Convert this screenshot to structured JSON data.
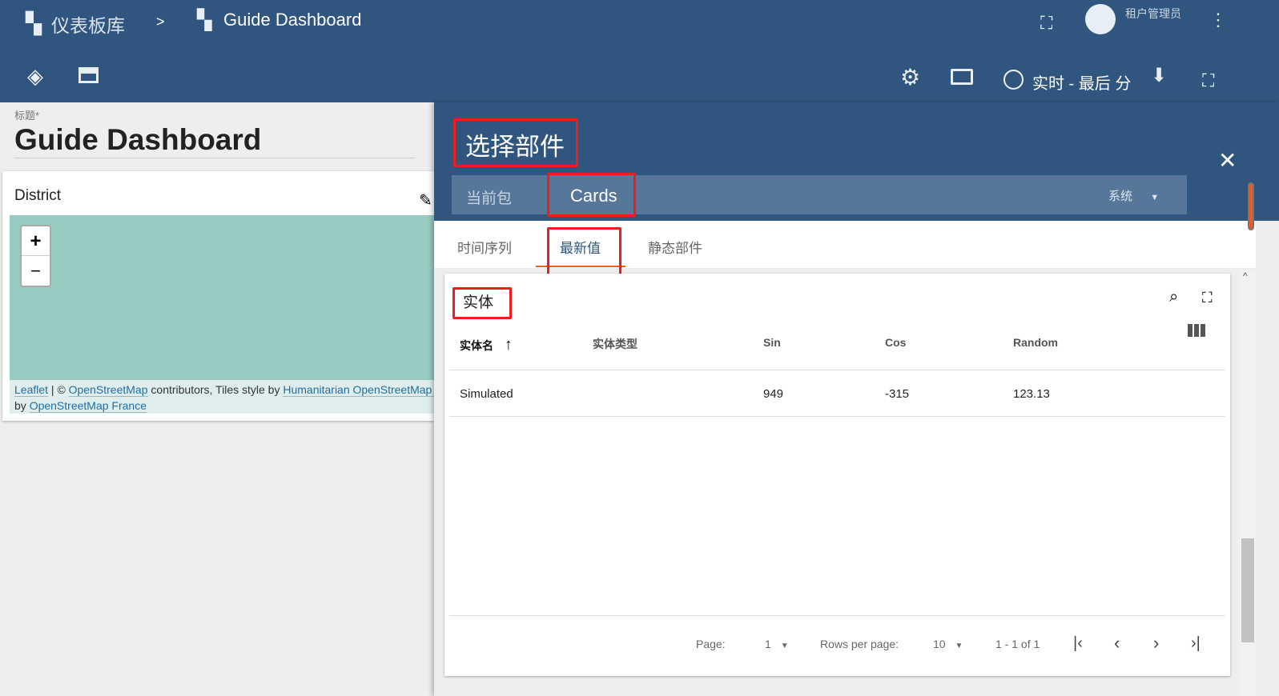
{
  "header": {
    "breadcrumb": [
      {
        "label": "仪表板库",
        "icon": "dashboards-icon"
      },
      {
        "label": "Guide Dashboard",
        "icon": "dashboard-icon"
      }
    ],
    "separator": ">",
    "user": "租户管理员",
    "timewindow": "实时 - 最后 分"
  },
  "left": {
    "title_label": "标题",
    "required": "*",
    "title_value": "Guide Dashboard",
    "widget_title": "District",
    "map": {
      "zoom_in": "+",
      "zoom_out": "−",
      "attr_leaflet": "Leaflet",
      "attr_sep": " | © ",
      "attr_osm": "OpenStreetMap",
      "attr_contrib": " contributors, Tiles style by ",
      "attr_hot": "Humanitarian OpenStreetMap T",
      "attr_by": "by ",
      "attr_osmfr": "OpenStreetMap France"
    }
  },
  "panel": {
    "title": "选择部件",
    "bundle_tabs": [
      "当前包",
      "Cards"
    ],
    "bundle_select": "系统",
    "widget_tabs": [
      "时间序列",
      "最新值",
      "静态部件"
    ],
    "active_widget_tab": 1,
    "table": {
      "title": "实体",
      "columns": [
        "实体名",
        "实体类型",
        "Sin",
        "Cos",
        "Random"
      ],
      "rows": [
        [
          "Simulated",
          "",
          "949",
          "-315",
          "123.13"
        ]
      ],
      "pagination": {
        "page_label": "Page:",
        "page": "1",
        "rows_label": "Rows per page:",
        "rows": "10",
        "range": "1 - 1 of 1"
      }
    }
  },
  "colors": {
    "header": "#305680",
    "tabbar": "#56769a",
    "accent": "#f01c1c",
    "map": "#97cac1"
  }
}
